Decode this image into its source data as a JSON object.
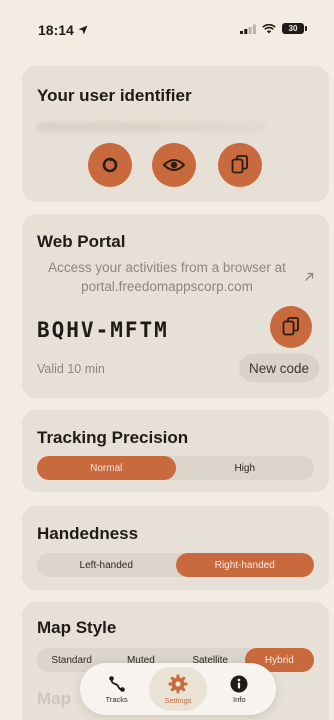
{
  "status": {
    "time": "18:14",
    "battery": "30"
  },
  "user_identifier": {
    "title": "Your user identifier",
    "buttons": [
      "refresh-icon",
      "eye-icon",
      "copy-icon"
    ]
  },
  "web_portal": {
    "title": "Web Portal",
    "subtitle": "Access your activities from a browser at portal.freedomappscorp.com",
    "code": "BQHV-MFTM",
    "valid": "Valid 10 min",
    "new_code_label": "New code"
  },
  "tracking_precision": {
    "title": "Tracking Precision",
    "options": [
      "Normal",
      "High"
    ],
    "selected": "Normal"
  },
  "handedness": {
    "title": "Handedness",
    "options": [
      "Left-handed",
      "Right-handed"
    ],
    "selected": "Right-handed"
  },
  "map_style": {
    "title": "Map Style",
    "options": [
      "Standard",
      "Muted",
      "Satellite",
      "Hybrid"
    ],
    "selected": "Hybrid"
  },
  "next_section_partial": "Map",
  "tabbar": {
    "tabs": [
      {
        "label": "Tracks",
        "icon": "route-icon"
      },
      {
        "label": "Settings",
        "icon": "gear-icon"
      },
      {
        "label": "Info",
        "icon": "info-icon"
      }
    ],
    "active": "Settings"
  },
  "colors": {
    "accent": "#c96a3e",
    "background": "#f2ece3",
    "card": "#e7e0d6"
  }
}
